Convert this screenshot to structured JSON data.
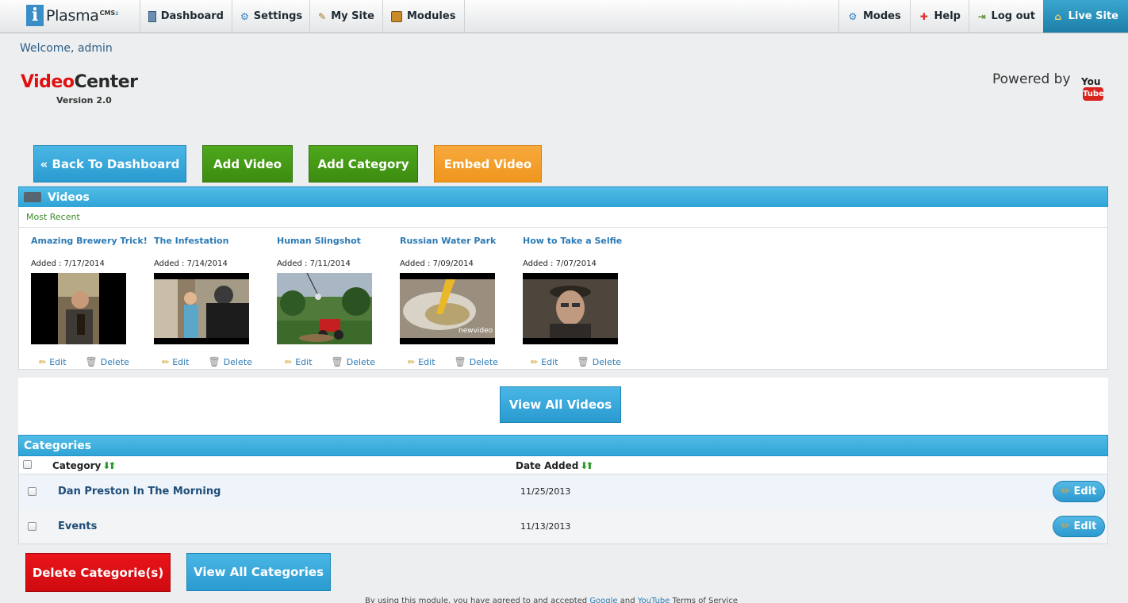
{
  "topnav": {
    "logo": {
      "letter": "i",
      "text": "Plasma",
      "sup": "CMS",
      "sup_num": "2"
    },
    "left": [
      {
        "label": "Dashboard",
        "icon": "dashboard-icon"
      },
      {
        "label": "Settings",
        "icon": "gear-icon"
      },
      {
        "label": "My Site",
        "icon": "edit-site-icon"
      },
      {
        "label": "Modules",
        "icon": "modules-icon"
      }
    ],
    "right": [
      {
        "label": "Modes",
        "icon": "gears-icon"
      },
      {
        "label": "Help",
        "icon": "lifebuoy-icon"
      },
      {
        "label": "Log out",
        "icon": "logout-icon"
      },
      {
        "label": "Live Site",
        "icon": "home-icon"
      }
    ]
  },
  "welcome": "Welcome, admin",
  "app": {
    "title_red": "Video",
    "title_dark": "Center",
    "version": "Version 2.0"
  },
  "powered": {
    "text": "Powered by",
    "badge_top": "You",
    "badge_tube": "Tube"
  },
  "actions": {
    "back": "« Back To Dashboard",
    "add_video": "Add Video",
    "add_category": "Add Category",
    "embed_video": "Embed Video"
  },
  "videos": {
    "heading": "Videos",
    "subheading": "Most Recent",
    "edit_label": "Edit",
    "delete_label": "Delete",
    "items": [
      {
        "title": "Amazing Brewery Trick!",
        "added": "Added : 7/17/2014"
      },
      {
        "title": "The Infestation",
        "added": "Added : 7/14/2014"
      },
      {
        "title": "Human Slingshot",
        "added": "Added : 7/11/2014"
      },
      {
        "title": "Russian Water Park",
        "added": "Added : 7/09/2014",
        "overlay": "newvideo"
      },
      {
        "title": "How to Take a Selfie",
        "added": "Added : 7/07/2014"
      }
    ],
    "view_all": "View All Videos"
  },
  "categories": {
    "heading": "Categories",
    "col_category": "Category",
    "col_date": "Date Added",
    "edit_label": "Edit",
    "rows": [
      {
        "name": "Dan Preston In The Morning",
        "date": "11/25/2013"
      },
      {
        "name": "Events",
        "date": "11/13/2013"
      }
    ],
    "delete_btn": "Delete Categorie(s)",
    "view_all_btn": "View All Categories"
  },
  "footer": {
    "text_a": "By using this module, you have agreed to and accepted ",
    "link1": "Google",
    "text_b": " and ",
    "link2": "YouTube",
    "text_c": " Terms of Service"
  }
}
